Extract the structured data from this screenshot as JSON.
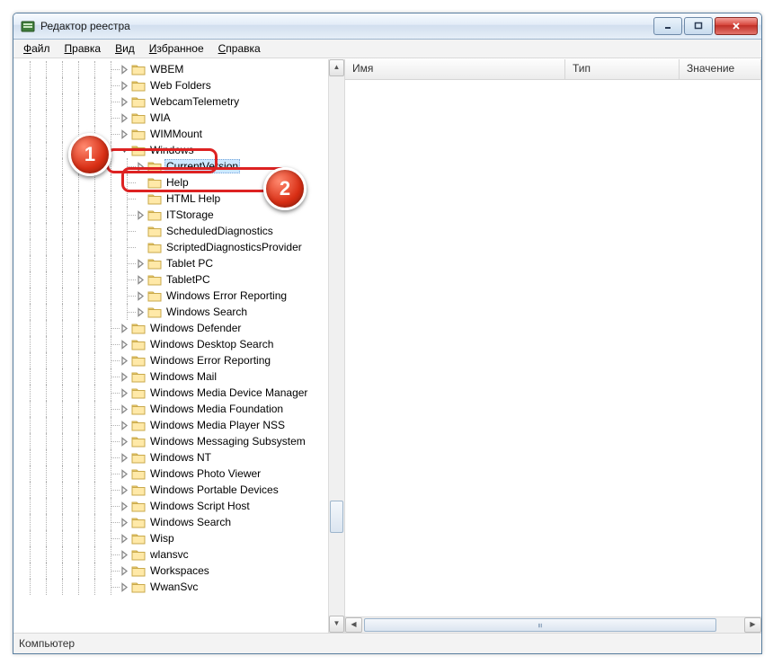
{
  "window": {
    "title": "Редактор реестра"
  },
  "menubar": {
    "items": [
      {
        "letter": "Ф",
        "rest": "айл"
      },
      {
        "letter": "П",
        "rest": "равка"
      },
      {
        "letter": "В",
        "rest": "ид"
      },
      {
        "letter": "И",
        "rest": "збранное"
      },
      {
        "letter": "С",
        "rest": "правка"
      }
    ]
  },
  "columns": {
    "name": "Имя",
    "type": "Тип",
    "value": "Значение"
  },
  "statusbar": {
    "path": "Компьютер"
  },
  "badges": {
    "one": "1",
    "two": "2"
  },
  "tree": {
    "base_indent": 108,
    "step": 18,
    "guide_levels": [
      18,
      36,
      54,
      72,
      90,
      108
    ],
    "items": [
      {
        "depth": 0,
        "exp": "closed",
        "label": "WBEM"
      },
      {
        "depth": 0,
        "exp": "closed",
        "label": "Web Folders"
      },
      {
        "depth": 0,
        "exp": "closed",
        "label": "WebcamTelemetry"
      },
      {
        "depth": 0,
        "exp": "closed",
        "label": "WIA"
      },
      {
        "depth": 0,
        "exp": "closed",
        "label": "WIMMount"
      },
      {
        "depth": 0,
        "exp": "open",
        "label": "Windows",
        "callout": 1
      },
      {
        "depth": 1,
        "exp": "closed",
        "label": "CurrentVersion",
        "selected": true,
        "callout": 2
      },
      {
        "depth": 1,
        "exp": "none",
        "label": "Help"
      },
      {
        "depth": 1,
        "exp": "none",
        "label": "HTML Help"
      },
      {
        "depth": 1,
        "exp": "closed",
        "label": "ITStorage"
      },
      {
        "depth": 1,
        "exp": "none",
        "label": "ScheduledDiagnostics"
      },
      {
        "depth": 1,
        "exp": "none",
        "label": "ScriptedDiagnosticsProvider"
      },
      {
        "depth": 1,
        "exp": "closed",
        "label": "Tablet PC"
      },
      {
        "depth": 1,
        "exp": "closed",
        "label": "TabletPC"
      },
      {
        "depth": 1,
        "exp": "closed",
        "label": "Windows Error Reporting"
      },
      {
        "depth": 1,
        "exp": "closed",
        "label": "Windows Search"
      },
      {
        "depth": 0,
        "exp": "closed",
        "label": "Windows Defender"
      },
      {
        "depth": 0,
        "exp": "closed",
        "label": "Windows Desktop Search"
      },
      {
        "depth": 0,
        "exp": "closed",
        "label": "Windows Error Reporting"
      },
      {
        "depth": 0,
        "exp": "closed",
        "label": "Windows Mail"
      },
      {
        "depth": 0,
        "exp": "closed",
        "label": "Windows Media Device Manager"
      },
      {
        "depth": 0,
        "exp": "closed",
        "label": "Windows Media Foundation"
      },
      {
        "depth": 0,
        "exp": "closed",
        "label": "Windows Media Player NSS"
      },
      {
        "depth": 0,
        "exp": "closed",
        "label": "Windows Messaging Subsystem"
      },
      {
        "depth": 0,
        "exp": "closed",
        "label": "Windows NT"
      },
      {
        "depth": 0,
        "exp": "closed",
        "label": "Windows Photo Viewer"
      },
      {
        "depth": 0,
        "exp": "closed",
        "label": "Windows Portable Devices"
      },
      {
        "depth": 0,
        "exp": "closed",
        "label": "Windows Script Host"
      },
      {
        "depth": 0,
        "exp": "closed",
        "label": "Windows Search"
      },
      {
        "depth": 0,
        "exp": "closed",
        "label": "Wisp"
      },
      {
        "depth": 0,
        "exp": "closed",
        "label": "wlansvc"
      },
      {
        "depth": 0,
        "exp": "closed",
        "label": "Workspaces"
      },
      {
        "depth": 0,
        "exp": "closed",
        "label": "WwanSvc"
      }
    ]
  }
}
